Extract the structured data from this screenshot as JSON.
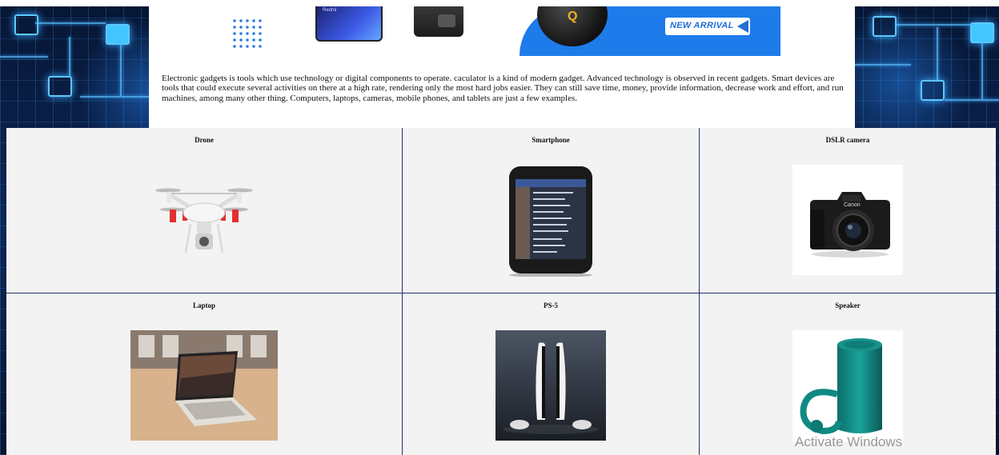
{
  "banner": {
    "phone_brand": "Redmi",
    "headphone_logo": "Q",
    "badge_text": "NEW ARRIVAL"
  },
  "intro": {
    "text": "Electronic gadgets is tools which use technology or digital components to operate. caculator is a kind of modern gadget. Advanced technology is observed in recent gadgets. Smart devices are tools that could execute several activities on there at a high rate, rendering only the most hard jobs easier. They can still save time, money, provide information, decrease work and effort, and run machines, among many other thing. Computers, laptops, cameras, mobile phones, and tablets are just a few examples."
  },
  "products": [
    {
      "title": "Drone",
      "image": "drone-image"
    },
    {
      "title": "Smartphone",
      "image": "smartphone-image"
    },
    {
      "title": "DSLR camera",
      "image": "dslr-camera-image"
    },
    {
      "title": "Laptop",
      "image": "laptop-image"
    },
    {
      "title": "PS-5",
      "image": "ps5-image"
    },
    {
      "title": "Speaker",
      "image": "speaker-image"
    }
  ],
  "watermark": "Activate Windows",
  "colors": {
    "background": "#0b1a3a",
    "circuit_glow": "#43c6ff",
    "banner_blue": "#1e7bea",
    "cell_bg": "#f3f3f3",
    "grid_border": "#1e3466"
  }
}
